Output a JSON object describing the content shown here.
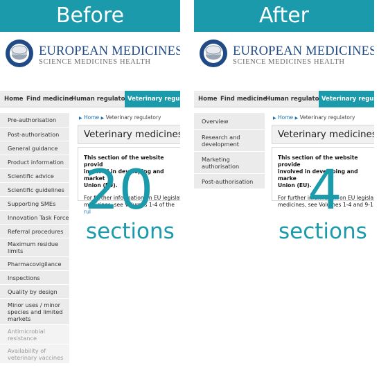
{
  "colors": {
    "accent": "#1a9aaa",
    "brand_blue": "#1f4a86"
  },
  "before": {
    "banner": "Before",
    "agency_name": "EUROPEAN MEDICINES AGEN",
    "tagline": "SCIENCE MEDICINES HEALTH",
    "nav": [
      "Home",
      "Find medicine",
      "Human regulatory",
      "Veterinary regulato"
    ],
    "sidebar": [
      "Pre-authorisation",
      "Post-authorisation",
      "General guidance",
      "Product information",
      "Scientific advice",
      "Scientific guidelines",
      "Supporting SMEs",
      "Innovation Task Force",
      "Referral procedures",
      "Maximum residue\nlimits",
      "Pharmacovigilance",
      "Inspections",
      "Quality by design",
      "Minor uses / minor\nspecies and limited\nmarkets",
      "Antimicrobial\nresistance",
      "Availability of\nveterinary vaccines"
    ],
    "breadcrumb_home": "Home",
    "breadcrumb_current": "Veterinary regulatory",
    "page_title": "Veterinary medicines:",
    "content_bold": "This section of the website provid\ninvolved in developing and market\nUnion (EU).",
    "content_text_a": "For further information on EU legislat\nmedicines, see Volumes 1-4 of the ",
    "content_link": "rul",
    "count": "20",
    "count_label": "sections"
  },
  "after": {
    "banner": "After",
    "agency_name": "EUROPEAN MEDICINES AGEN",
    "tagline": "SCIENCE MEDICINES HEALTH",
    "nav": [
      "Home",
      "Find medicine",
      "Human regulatory",
      "Veterinary regulato"
    ],
    "sidebar": [
      "Overview",
      "Research and\ndevelopment",
      "Marketing\nauthorisation",
      "Post-authorisation"
    ],
    "breadcrumb_home": "Home",
    "breadcrumb_current": "Veterinary regulatory",
    "page_title": "Veterinary medicines:",
    "content_bold": "This section of the website provide\ninvolved in developing and marke\nUnion (EU).",
    "content_text_a": "For further information on EU legisla\nmedicines, see Volumes 1-4 and 9-1",
    "content_link": "",
    "count": "4",
    "count_label": "sections"
  }
}
